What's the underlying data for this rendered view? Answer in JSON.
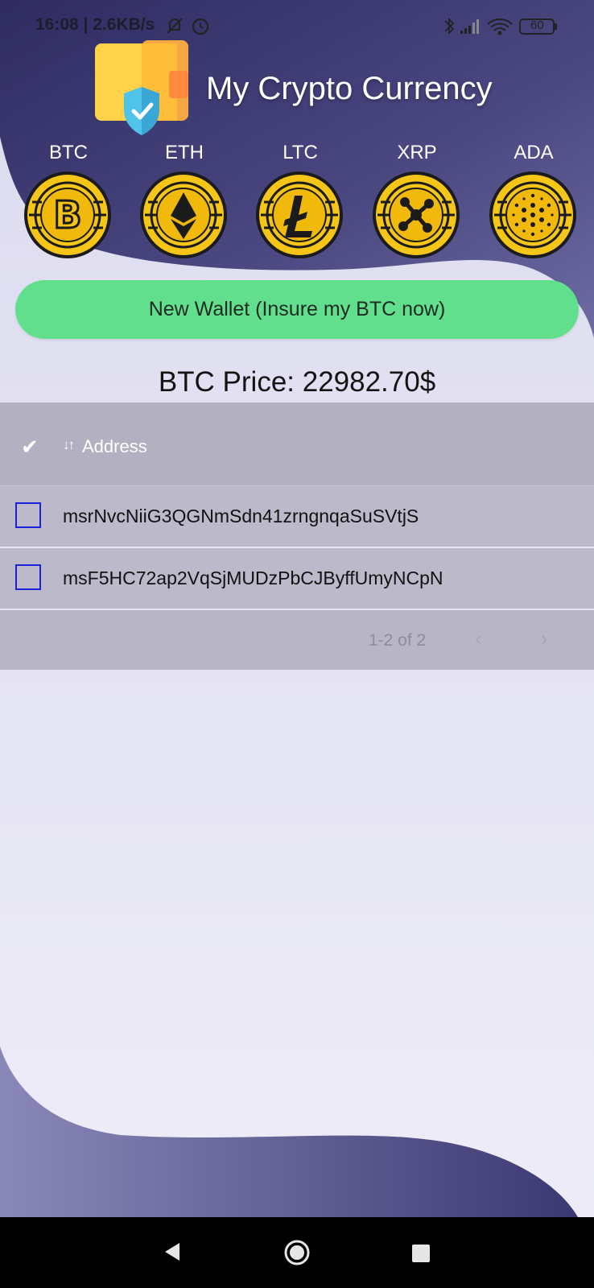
{
  "status_bar": {
    "time": "16:08 | 2.6KB/s",
    "battery": "60",
    "icons": [
      "mute-bell-icon",
      "alarm-icon",
      "bluetooth-icon",
      "signal-icon",
      "wifi-icon",
      "battery-icon"
    ]
  },
  "header": {
    "title": "My Crypto Currency",
    "logo_icon": "wallet-shield-icon"
  },
  "coins": [
    {
      "label": "BTC",
      "icon": "bitcoin-coin-icon"
    },
    {
      "label": "ETH",
      "icon": "ethereum-coin-icon"
    },
    {
      "label": "LTC",
      "icon": "litecoin-coin-icon"
    },
    {
      "label": "XRP",
      "icon": "ripple-coin-icon"
    },
    {
      "label": "ADA",
      "icon": "cardano-coin-icon"
    }
  ],
  "wallet_button": {
    "label": "New Wallet (Insure my BTC now)",
    "color": "#61df8d"
  },
  "price": {
    "text": "BTC Price: 22982.70$"
  },
  "table": {
    "select_all_glyph": "✔",
    "sort_glyph": "↓↑",
    "column_header": "Address",
    "rows": [
      {
        "address": "msrNvcNiiG3QGNmSdn41zrngnqaSuSVtjS"
      },
      {
        "address": "msF5HC72ap2VqSjMUDzPbCJByffUmyNCpN"
      }
    ],
    "pagination": {
      "range": "1-2 of 2",
      "prev": "‹",
      "next": "›"
    }
  },
  "colors": {
    "header_bg": "#3d3a72",
    "page_bg": "#e4e3f2",
    "coin_gold": "#f5c518",
    "checkbox_border": "#1a22d9"
  }
}
